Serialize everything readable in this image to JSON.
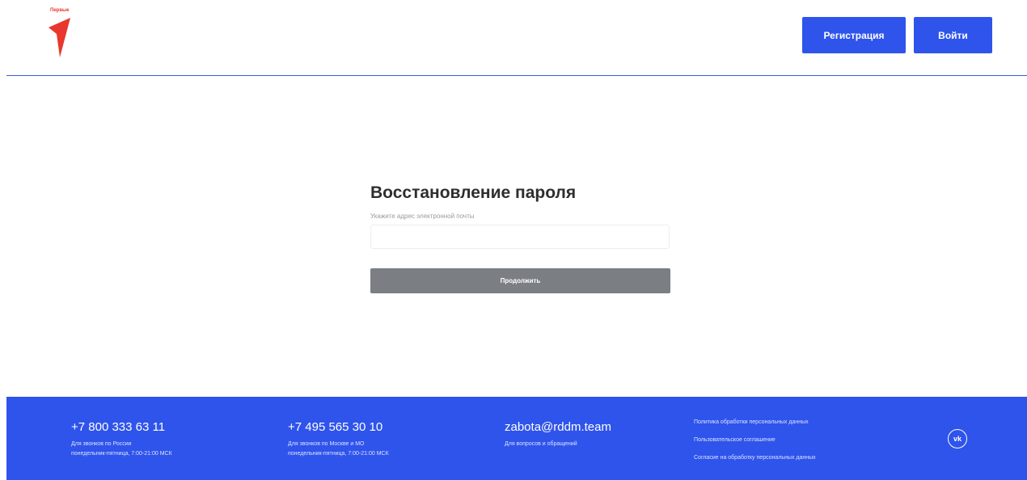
{
  "header": {
    "logo_text": "Первые",
    "register_label": "Регистрация",
    "login_label": "Войти"
  },
  "form": {
    "title": "Восстановление пароля",
    "email_label": "Укажите адрес электронной почты",
    "email_value": "",
    "email_placeholder": "",
    "continue_label": "Продолжить"
  },
  "footer": {
    "phone_russia": "+7 800 333 63 11",
    "phone_russia_note_1": "Для звонков по России",
    "phone_russia_note_2": "понедельник-пятница, 7:00-21:00 МСК",
    "phone_moscow": "+7 495 565 30 10",
    "phone_moscow_note_1": "Для звонков по Москве и МО",
    "phone_moscow_note_2": "понедельник-пятница, 7:00-21:00 МСК",
    "email": "zabota@rddm.team",
    "email_note": "Для вопросов и обращений",
    "links": [
      "Политика обработки персональных данных",
      "Пользовательское соглашение",
      "Согласие на обработку персональных данных"
    ],
    "social_icon": "vk-icon",
    "vk_glyph": "vk"
  },
  "colors": {
    "brand_blue": "#2f54eb",
    "logo_red": "#e8372c",
    "button_gray": "#7b7f84"
  }
}
